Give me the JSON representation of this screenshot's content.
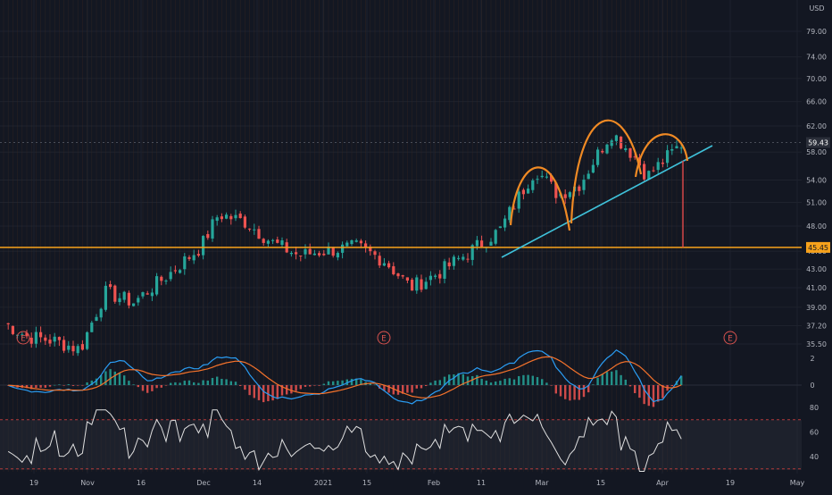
{
  "currency": "USD",
  "colors": {
    "background": "#131722",
    "grid": "#1e222d",
    "up": "#26a69a",
    "down": "#ef5350",
    "axis_text": "#b2b5be",
    "support": "#f7a21b",
    "pattern": "#f08a24",
    "trendline": "#3fc1d9",
    "macd_line": "#2a9df4",
    "signal_line": "#f4722b",
    "rsi_line": "#e0e0e0",
    "rsi_band": "#2a2e39",
    "rsi_level": "#b23a3a"
  },
  "price_axis": {
    "ticks": [
      "79.00",
      "74.00",
      "70.00",
      "66.00",
      "62.00",
      "58.00",
      "54.00",
      "51.00",
      "48.00",
      "45.00",
      "43.00",
      "41.00",
      "39.00",
      "37.20",
      "35.50"
    ],
    "last_price": "59.43",
    "support_level_label": "45.45"
  },
  "macd_axis": {
    "ticks": [
      "2",
      "0"
    ]
  },
  "rsi_axis": {
    "ticks": [
      "80",
      "60",
      "40"
    ]
  },
  "time_axis": {
    "ticks": [
      "19",
      "Nov",
      "16",
      "Dec",
      "14",
      "2021",
      "15",
      "Feb",
      "11",
      "Mar",
      "15",
      "Apr",
      "19",
      "May"
    ]
  },
  "earnings_markers": [
    "E",
    "E",
    "E"
  ],
  "chart_data": {
    "type": "candlestick",
    "title": "",
    "x_labels": [
      "19",
      "Nov",
      "16",
      "Dec",
      "14",
      "2021",
      "15",
      "Feb",
      "11",
      "Mar",
      "15",
      "Apr",
      "19",
      "May"
    ],
    "y_ticks": [
      79,
      74,
      70,
      66,
      62,
      58,
      54,
      51,
      48,
      45,
      43,
      41,
      39,
      37.2,
      35.5
    ],
    "log_scale": true,
    "last_price": 59.43,
    "support_level": 45.45,
    "grid": true,
    "indicators": [
      "MACD",
      "RSI"
    ],
    "rsi_levels": [
      70,
      30
    ],
    "annotations": [
      "head-and-shoulders pattern",
      "ascending trendline",
      "horizontal support line"
    ],
    "close_series": [
      {
        "t": "Oct 10",
        "c": 37.5
      },
      {
        "t": "Oct 19",
        "c": 36.2
      },
      {
        "t": "Oct 26",
        "c": 35.8
      },
      {
        "t": "Nov 2",
        "c": 35.0
      },
      {
        "t": "Nov 9",
        "c": 40.5
      },
      {
        "t": "Nov 16",
        "c": 39.5
      },
      {
        "t": "Nov 23",
        "c": 42.5
      },
      {
        "t": "Nov 30",
        "c": 45.5
      },
      {
        "t": "Dec 7",
        "c": 49.5
      },
      {
        "t": "Dec 14",
        "c": 48.5
      },
      {
        "t": "Dec 21",
        "c": 46.0
      },
      {
        "t": "Dec 28",
        "c": 44.5
      },
      {
        "t": "Jan 4",
        "c": 45.0
      },
      {
        "t": "Jan 11",
        "c": 45.5
      },
      {
        "t": "Jan 18",
        "c": 44.0
      },
      {
        "t": "Jan 25",
        "c": 41.0
      },
      {
        "t": "Feb 1",
        "c": 42.5
      },
      {
        "t": "Feb 8",
        "c": 44.5
      },
      {
        "t": "Feb 15",
        "c": 47.5
      },
      {
        "t": "Feb 22",
        "c": 55.5
      },
      {
        "t": "Mar 1",
        "c": 52.0
      },
      {
        "t": "Mar 8",
        "c": 53.5
      },
      {
        "t": "Mar 15",
        "c": 61.0
      },
      {
        "t": "Mar 22",
        "c": 57.5
      },
      {
        "t": "Mar 29",
        "c": 54.5
      },
      {
        "t": "Apr 1",
        "c": 59.43
      }
    ]
  }
}
